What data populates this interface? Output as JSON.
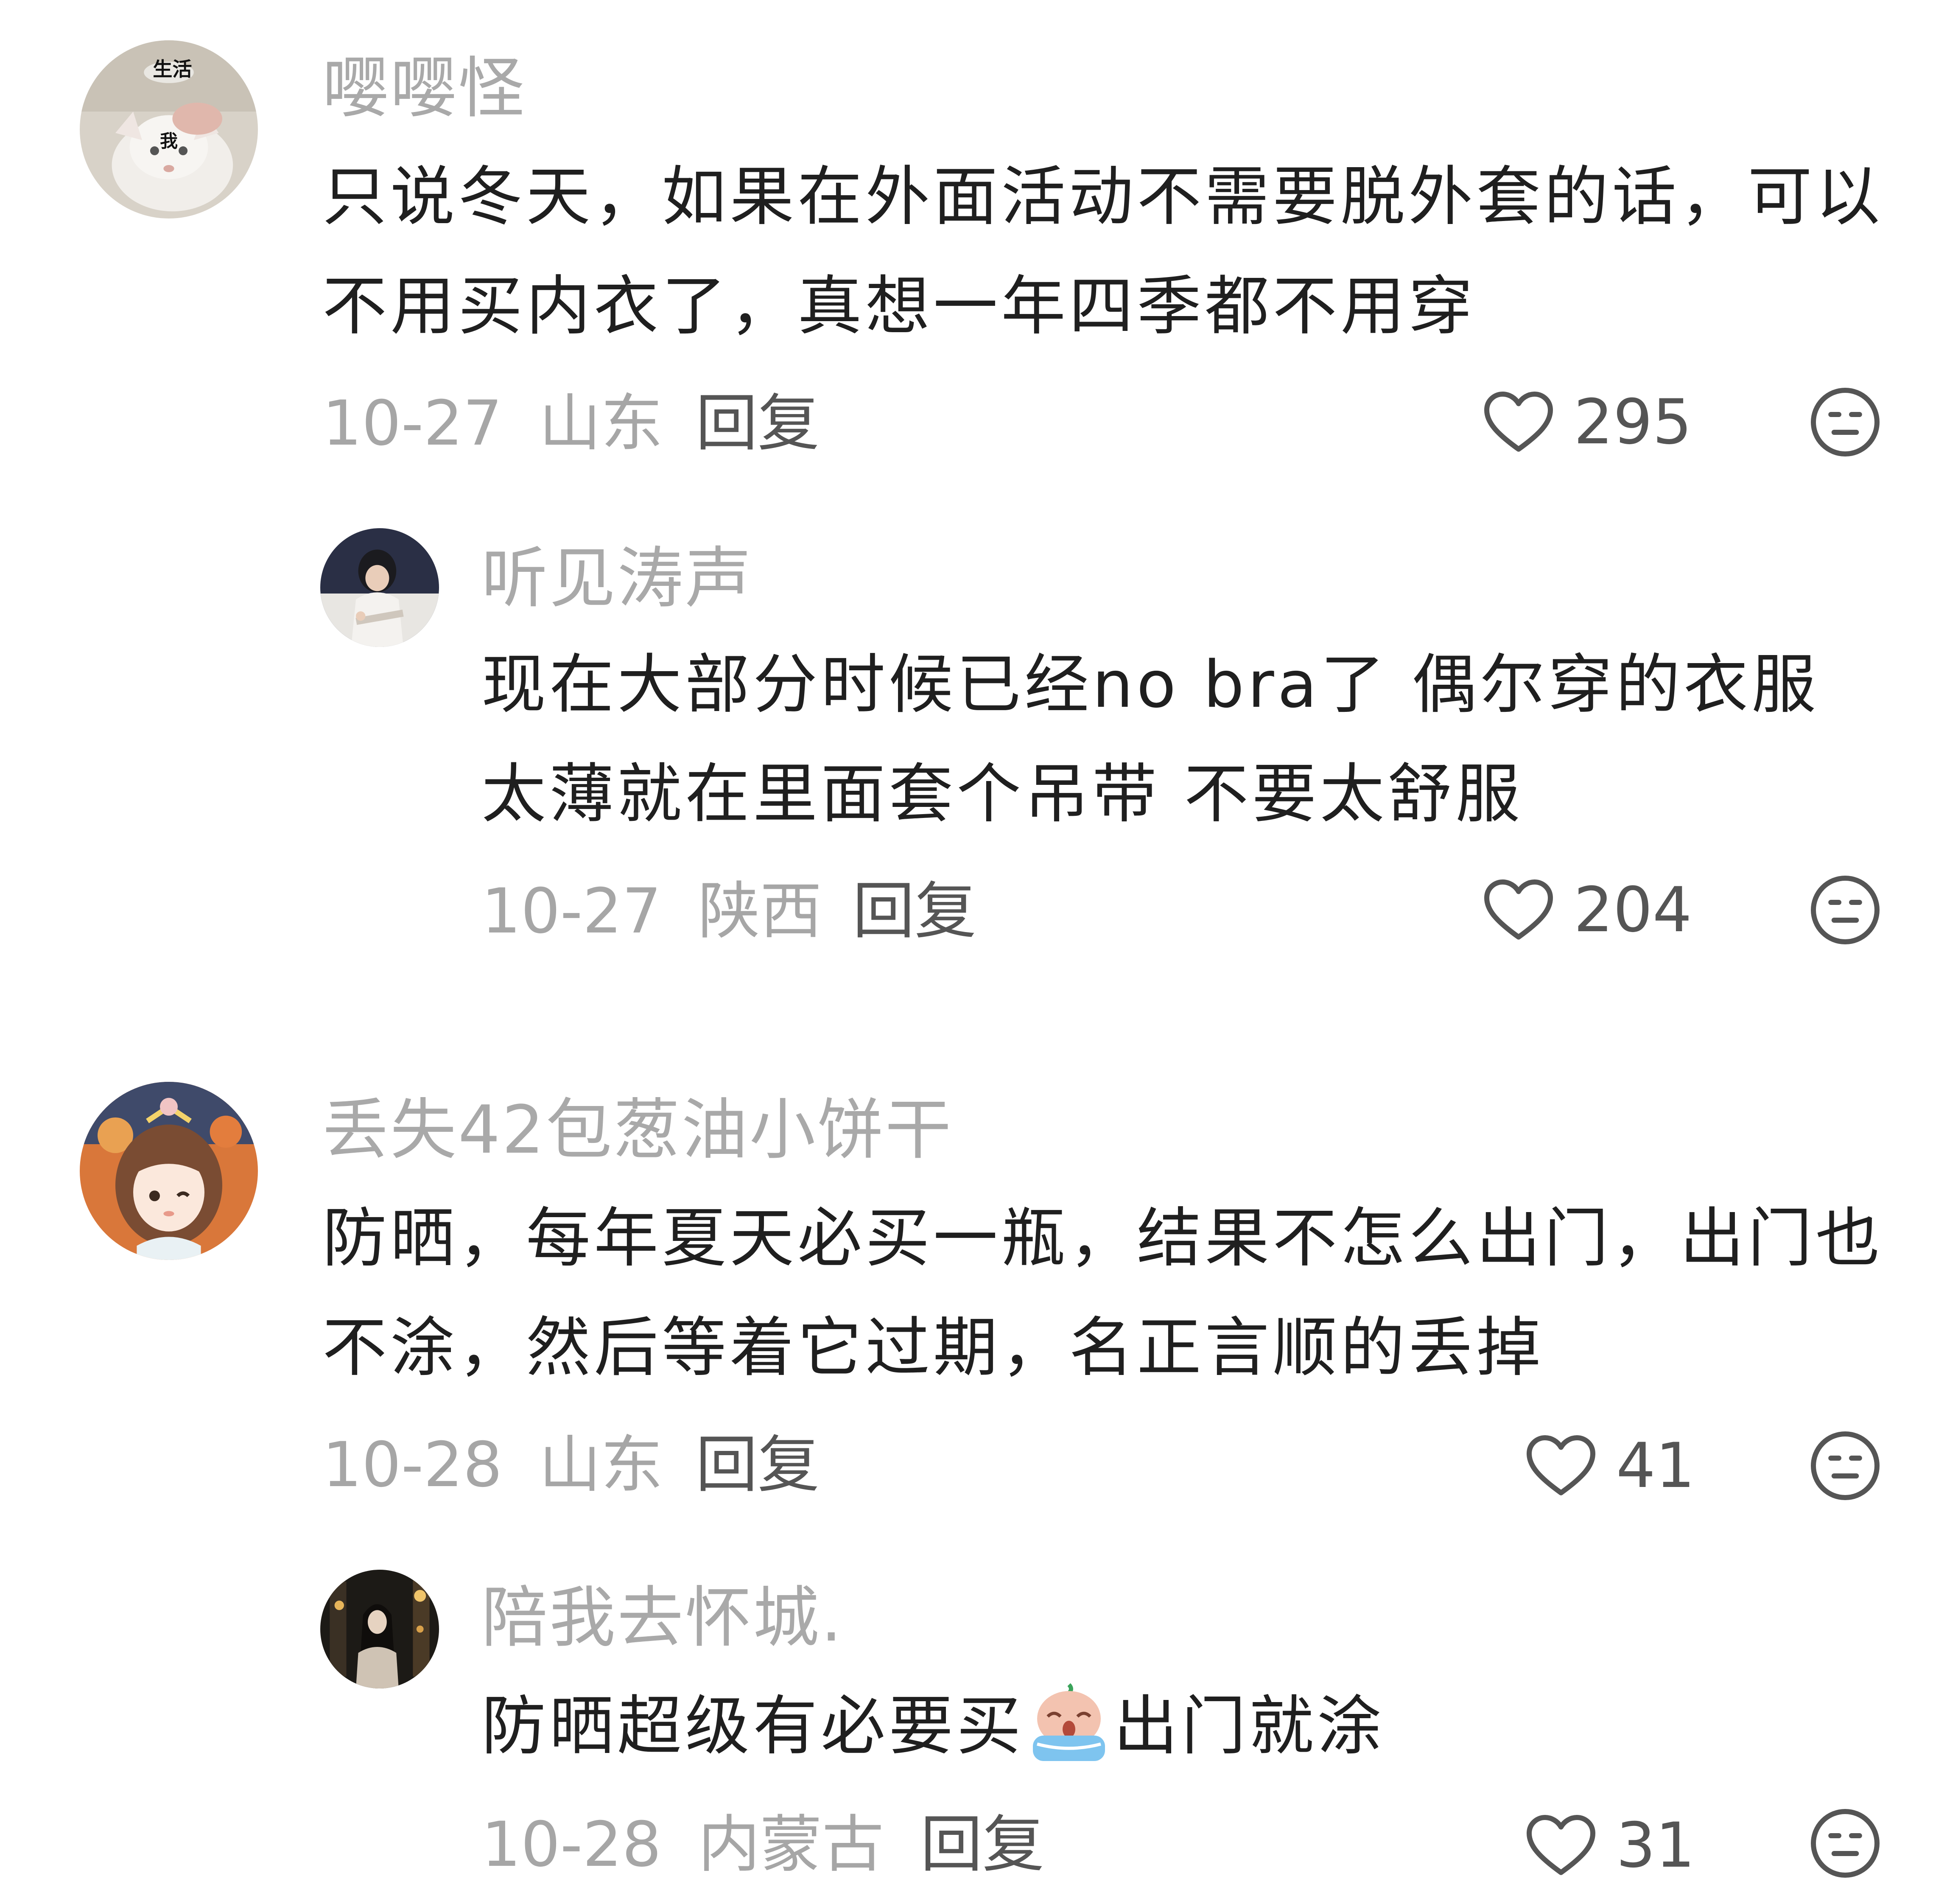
{
  "comments": [
    {
      "username": "嘤嘤怪",
      "avatar_icon": "cat-avatar-icon",
      "avatar_text_top": "生活",
      "avatar_text_mid": "我",
      "text": "只说冬天，如果在外面活动不需要脱外套的话，可以不用买内衣了，真想一年四季都不用穿",
      "date": "10-27",
      "location": "山东",
      "reply_label": "回复",
      "likes": "295"
    },
    {
      "username": "听见涛声",
      "avatar_icon": "person-writing-avatar-icon",
      "text": "现在大部分时候已经no bra了 偶尔穿的衣服太薄就在里面套个吊带 不要太舒服",
      "date": "10-27",
      "location": "陕西",
      "reply_label": "回复",
      "likes": "204"
    },
    {
      "username": "丢失42包葱油小饼干",
      "avatar_icon": "anime-girl-avatar-icon",
      "text": "防晒，每年夏天必买一瓶，结果不怎么出门，出门也不涂，然后等着它过期，名正言顺的丢掉",
      "date": "10-28",
      "location": "山东",
      "reply_label": "回复",
      "likes": "41"
    },
    {
      "username": "陪我去怀城.",
      "avatar_icon": "night-street-avatar-icon",
      "text_before_emoji": "防晒超级有必要买",
      "emoji": "crying-emoji-icon",
      "text_after_emoji": "出门就涂",
      "date": "10-28",
      "location": "内蒙古",
      "reply_label": "回复",
      "likes": "31"
    }
  ],
  "colors": {
    "username": "#a9a9a9",
    "text": "#1f1f1f",
    "meta": "#a6a6a6",
    "action": "#555555"
  },
  "icons": {
    "like": "heart-outline-icon",
    "dislike": "neutral-face-icon"
  }
}
